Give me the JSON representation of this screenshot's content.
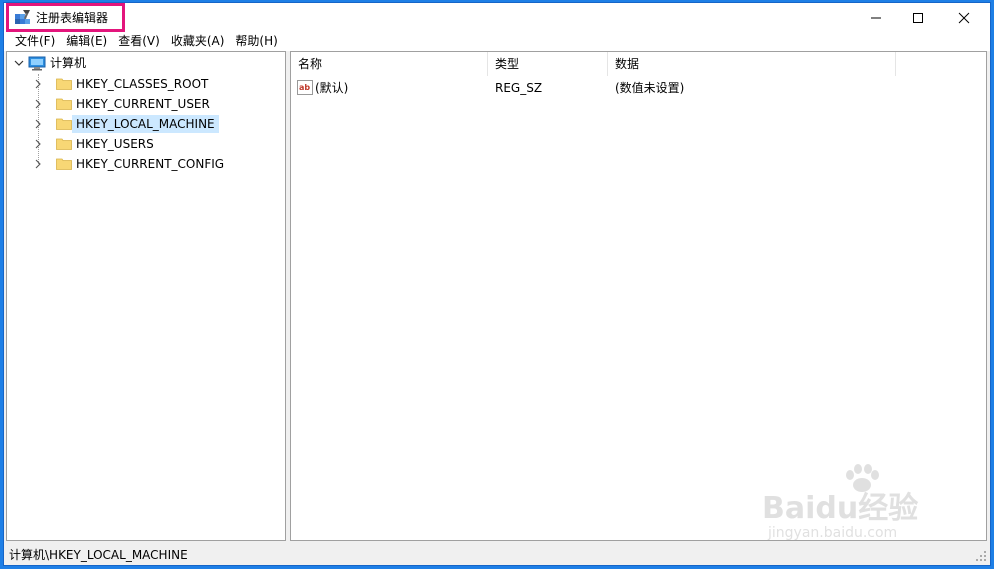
{
  "window": {
    "title": "注册表编辑器",
    "icon": "regedit-icon"
  },
  "window_buttons": {
    "minimize": "minimize-icon",
    "maximize": "maximize-icon",
    "close": "close-icon"
  },
  "menu": [
    {
      "label": "文件(F)"
    },
    {
      "label": "编辑(E)"
    },
    {
      "label": "查看(V)"
    },
    {
      "label": "收藏夹(A)"
    },
    {
      "label": "帮助(H)"
    }
  ],
  "tree": {
    "root": {
      "label": "计算机",
      "icon": "computer-icon",
      "expanded": true
    },
    "children": [
      {
        "label": "HKEY_CLASSES_ROOT",
        "selected": false
      },
      {
        "label": "HKEY_CURRENT_USER",
        "selected": false
      },
      {
        "label": "HKEY_LOCAL_MACHINE",
        "selected": true
      },
      {
        "label": "HKEY_USERS",
        "selected": false
      },
      {
        "label": "HKEY_CURRENT_CONFIG",
        "selected": false
      }
    ]
  },
  "list": {
    "columns": [
      "名称",
      "类型",
      "数据"
    ],
    "rows": [
      {
        "name": "(默认)",
        "type": "REG_SZ",
        "data": "(数值未设置)",
        "icon": "string-value-icon"
      }
    ]
  },
  "status": {
    "path": "计算机\\HKEY_LOCAL_MACHINE"
  },
  "watermark": {
    "main": "Baidu经验",
    "sub": "jingyan.baidu.com"
  },
  "colors": {
    "desktop": "#1e7fe6",
    "highlight_box": "#e3157c",
    "selection": "#cce8ff",
    "folder": "#f8d775"
  }
}
